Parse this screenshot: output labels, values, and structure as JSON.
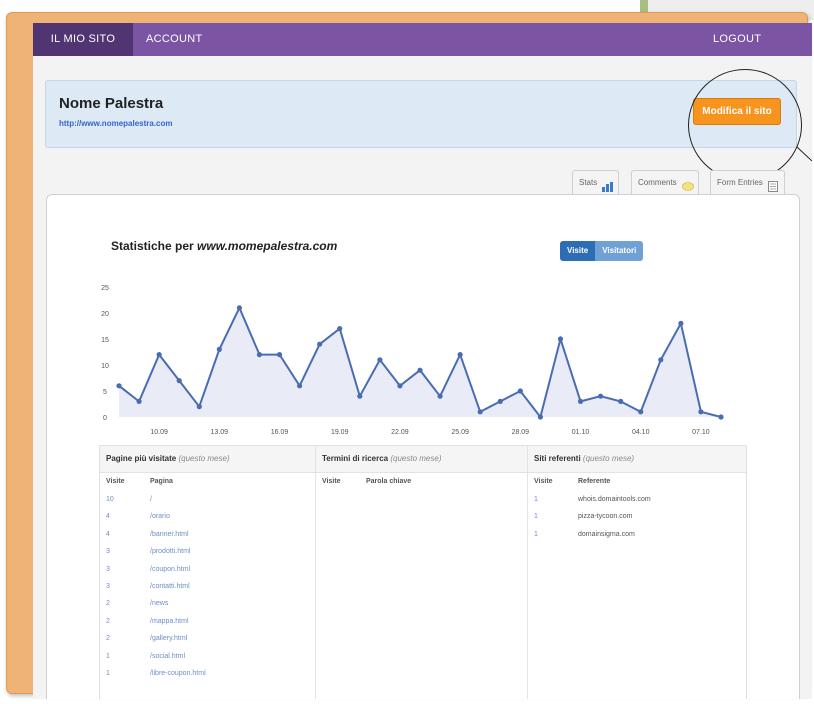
{
  "nav": {
    "items": [
      "IL MIO SITO",
      "ACCOUNT"
    ],
    "logout": "LOGOUT"
  },
  "site": {
    "name": "Nome Palestra",
    "url": "http://www.nomepalestra.com",
    "edit_button": "Modifica il sito"
  },
  "tabs": [
    "Stats",
    "Comments",
    "Form Entries"
  ],
  "stats": {
    "title_prefix": "Statistiche per ",
    "title_site": "www.momepalestra.com",
    "toggle": [
      "Visite",
      "Visitatori"
    ]
  },
  "chart_data": {
    "type": "area",
    "y_ticks": [
      "25",
      "20",
      "15",
      "10",
      "5",
      "0"
    ],
    "x_tick_labels": [
      "10.09",
      "13.09",
      "16.09",
      "19.09",
      "22.09",
      "25.09",
      "28.09",
      "01.10",
      "04.10",
      "07.10"
    ],
    "ylim": [
      0,
      25
    ],
    "series": [
      {
        "values": [
          6,
          3,
          12,
          7,
          2,
          13,
          21,
          12,
          12,
          6,
          14,
          17,
          4,
          11,
          6,
          9,
          4,
          12,
          1,
          3,
          5,
          0,
          15,
          3,
          4,
          3,
          1,
          11,
          18,
          1,
          0
        ]
      }
    ],
    "colors": {
      "line": "#4a6cb3",
      "fill": "#e9ecf6"
    }
  },
  "tables": {
    "pages": {
      "title": "Pagine più visitate",
      "period": "(questo mese)",
      "headers": [
        "Visite",
        "Pagina"
      ],
      "rows": [
        [
          "10",
          "/"
        ],
        [
          "4",
          "/orario"
        ],
        [
          "4",
          "/banner.html"
        ],
        [
          "3",
          "/prodotti.html"
        ],
        [
          "3",
          "/coupon.html"
        ],
        [
          "3",
          "/contatti.html"
        ],
        [
          "2",
          "/news"
        ],
        [
          "2",
          "/mappa.html"
        ],
        [
          "2",
          "/gallery.html"
        ],
        [
          "1",
          "/social.html"
        ],
        [
          "1",
          "/libre-coupon.html"
        ]
      ]
    },
    "search": {
      "title": "Termini di ricerca",
      "period": "(questo mese)",
      "headers": [
        "Visite",
        "Parola chiave"
      ],
      "rows": []
    },
    "referrers": {
      "title": "Siti referenti",
      "period": "(questo mese)",
      "headers": [
        "Visite",
        "Referente"
      ],
      "rows": [
        [
          "1",
          "whois.domaintools.com"
        ],
        [
          "1",
          "pizza-tycoon.com"
        ],
        [
          "1",
          "domainsigma.com"
        ]
      ]
    }
  }
}
